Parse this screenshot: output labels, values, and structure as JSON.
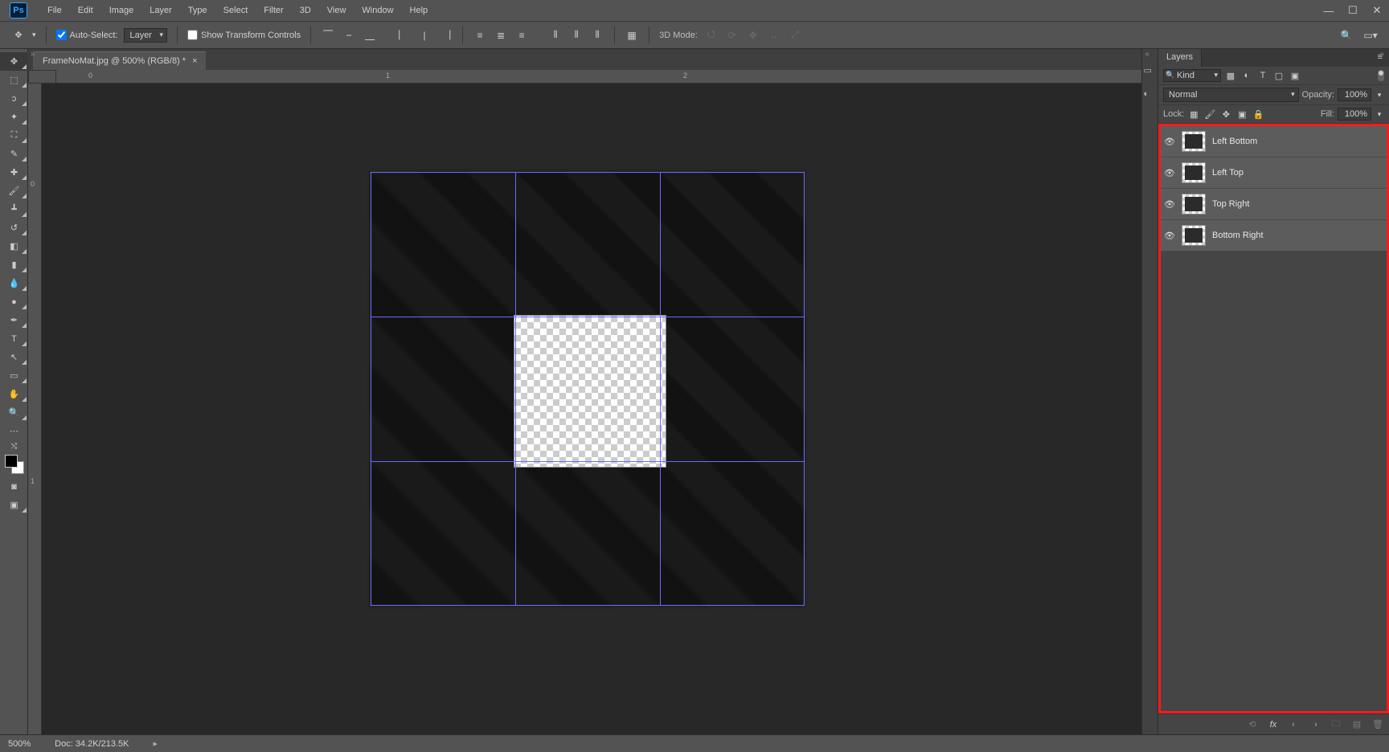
{
  "menu": {
    "items": [
      "File",
      "Edit",
      "Image",
      "Layer",
      "Type",
      "Select",
      "Filter",
      "3D",
      "View",
      "Window",
      "Help"
    ]
  },
  "options": {
    "auto_select_label": "Auto-Select:",
    "auto_select_value": "Layer",
    "show_tc_label": "Show Transform Controls",
    "mode3d_label": "3D Mode:"
  },
  "document": {
    "tab_title": "FrameNoMat.jpg @ 500% (RGB/8) *",
    "ruler_h": [
      "0",
      "1",
      "2"
    ],
    "ruler_v": [
      "0",
      "1"
    ]
  },
  "layers_panel": {
    "tab": "Layers",
    "filter_kind": "Kind",
    "blend_mode": "Normal",
    "opacity_label": "Opacity:",
    "opacity_value": "100%",
    "lock_label": "Lock:",
    "fill_label": "Fill:",
    "fill_value": "100%",
    "layers": [
      {
        "name": "Left Bottom"
      },
      {
        "name": "Left Top"
      },
      {
        "name": "Top Right"
      },
      {
        "name": "Bottom Right"
      }
    ]
  },
  "status": {
    "zoom": "500%",
    "doc_info": "Doc: 34.2K/213.5K"
  },
  "tools": [
    "move",
    "marquee",
    "lasso",
    "wand",
    "crop",
    "eyedrop",
    "heal",
    "brush",
    "stamp",
    "history",
    "eraser",
    "gradient",
    "blur",
    "dodge",
    "pen",
    "type",
    "path",
    "rect",
    "hand",
    "zoom",
    "more"
  ]
}
